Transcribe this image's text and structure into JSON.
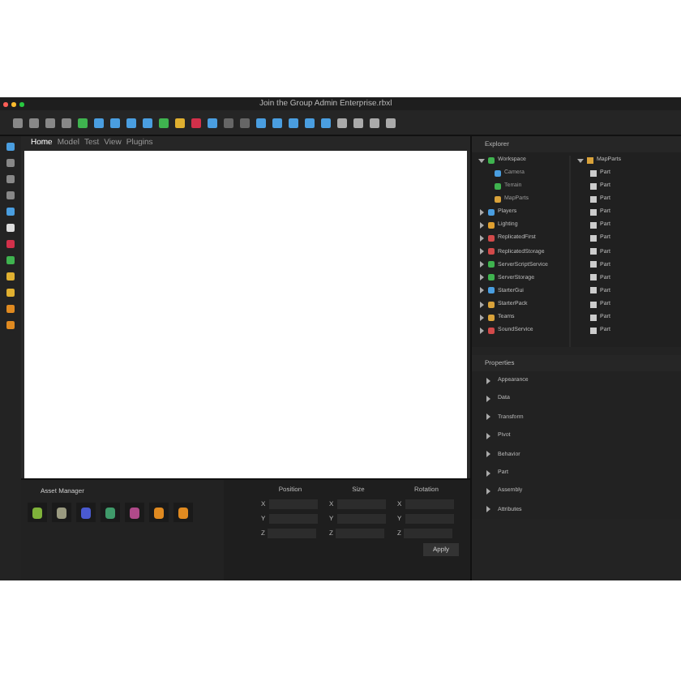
{
  "window": {
    "title": "Join the Group Admin Enterprise.rbxl"
  },
  "viewport_tabs": [
    {
      "label": "Home",
      "selected": true
    },
    {
      "label": "Model",
      "selected": false
    },
    {
      "label": "Test",
      "selected": false
    },
    {
      "label": "View",
      "selected": false
    },
    {
      "label": "Plugins",
      "selected": false
    }
  ],
  "explorer": {
    "title": "Explorer",
    "tree": [
      {
        "name": "Workspace",
        "color": "#3fb34f",
        "expanded": true,
        "children": [
          {
            "name": "Camera",
            "color": "#4a9ee0"
          },
          {
            "name": "Terrain",
            "color": "#3fb34f"
          },
          {
            "name": "MapParts",
            "color": "#d9a23a"
          }
        ]
      },
      {
        "name": "Players",
        "color": "#4a9ee0",
        "expanded": false
      },
      {
        "name": "Lighting",
        "color": "#e0a030",
        "expanded": false
      },
      {
        "name": "ReplicatedFirst",
        "color": "#d24a4a",
        "expanded": false
      },
      {
        "name": "ReplicatedStorage",
        "color": "#d24a4a",
        "expanded": false
      },
      {
        "name": "ServerScriptService",
        "color": "#3fb34f",
        "expanded": false
      },
      {
        "name": "ServerStorage",
        "color": "#3fb34f",
        "expanded": false
      },
      {
        "name": "StarterGui",
        "color": "#4a9ee0",
        "expanded": false
      },
      {
        "name": "StarterPack",
        "color": "#d9a23a",
        "expanded": false
      },
      {
        "name": "Teams",
        "color": "#d9a23a",
        "expanded": false
      },
      {
        "name": "SoundService",
        "color": "#d24a4a",
        "expanded": false
      }
    ],
    "folder": {
      "name": "MapParts",
      "children": [
        "Part",
        "Part",
        "Part",
        "Part",
        "Part",
        "Part",
        "Part",
        "Part",
        "Part",
        "Part",
        "Part",
        "Part",
        "Part"
      ]
    }
  },
  "properties": {
    "title": "Properties",
    "sections": [
      "Appearance",
      "Data",
      "Transform",
      "Pivot",
      "Behavior",
      "Part",
      "Assembly",
      "Attributes"
    ]
  },
  "asset_manager": {
    "title": "Asset Manager",
    "assets": [
      {
        "color": "#7fb23a"
      },
      {
        "color": "#9a9a80"
      },
      {
        "color": "#4a5ad0"
      },
      {
        "color": "#3f9a6a"
      },
      {
        "color": "#b04a8a"
      },
      {
        "color": "#e08a20"
      },
      {
        "color": "#e08a20"
      }
    ]
  },
  "transform": {
    "columns": [
      {
        "title": "Position",
        "axes": [
          "X",
          "Y",
          "Z"
        ]
      },
      {
        "title": "Size",
        "axes": [
          "X",
          "Y",
          "Z"
        ]
      },
      {
        "title": "Rotation",
        "axes": [
          "X",
          "Y",
          "Z"
        ]
      }
    ],
    "apply": "Apply"
  }
}
